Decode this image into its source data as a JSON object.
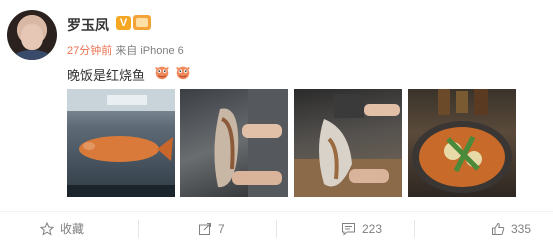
{
  "user": {
    "name": "罗玉凤",
    "verified_badge": "V"
  },
  "post": {
    "time": "27分钟前",
    "source": "来自 iPhone 6",
    "text": "晚饭是红烧鱼"
  },
  "emojis": [
    "crab-emoji",
    "crab-emoji"
  ],
  "actions": {
    "favorite_label": "收藏",
    "repost_count": "7",
    "comment_count": "223",
    "like_count": "335"
  },
  "colors": {
    "time": "#eb7350",
    "badge": "#f5a623",
    "meta": "#808080"
  }
}
